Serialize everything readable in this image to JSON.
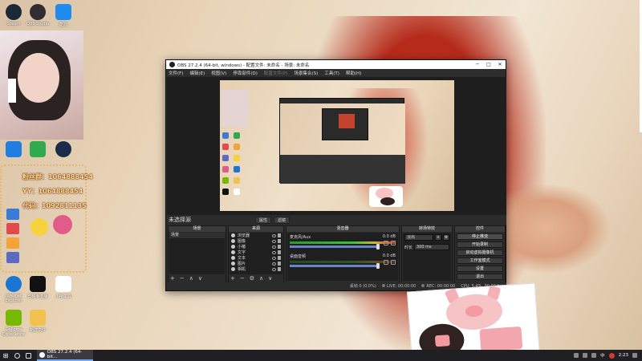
{
  "desktop": {
    "top_icons": [
      {
        "label": "Steam",
        "color": "#1b2838"
      },
      {
        "label": "OBS Studio",
        "color": "#302e31"
      },
      {
        "label": "酷狗",
        "color": "#1f8cf0"
      }
    ],
    "left_icons": [
      {
        "label": "",
        "color": "#1f7ee0"
      },
      {
        "label": "",
        "color": "#2faa4e"
      },
      {
        "label": "",
        "color": "#1d2b4a"
      }
    ],
    "overlay_texts": [
      "粉丝群：1064888454",
      "YY：1064888454",
      "代码：1092811135"
    ],
    "bottom_icons": [
      {
        "label": "Internet Explorer",
        "color": "#1a76d2"
      },
      {
        "label": "剪映专业版",
        "color": "#111111"
      },
      {
        "label": "小哈工具",
        "color": "#ffffff"
      },
      {
        "label": "GeForce Experience",
        "color": "#76b900"
      },
      {
        "label": "新建文件",
        "color": "#f2c14e"
      }
    ]
  },
  "obs": {
    "title": "OBS 27.2.4 (64-bit, windows) - 配置文件: 未命名 - 场景: 未命名",
    "menu": [
      {
        "label": "文件(F)",
        "dim": false
      },
      {
        "label": "编辑(E)",
        "dim": false
      },
      {
        "label": "视图(V)",
        "dim": false
      },
      {
        "label": "停靠部件(D)",
        "dim": false
      },
      {
        "label": "配置文件(P)",
        "dim": true
      },
      {
        "label": "场景集合(S)",
        "dim": false
      },
      {
        "label": "工具(T)",
        "dim": false
      },
      {
        "label": "帮助(H)",
        "dim": false
      }
    ],
    "scene_toolbar": {
      "left": "未选择源",
      "btn1": "属性",
      "btn2": "滤镜"
    },
    "docks": {
      "scenes": {
        "title": "场景",
        "items": [
          "场景"
        ]
      },
      "sources": {
        "title": "来源",
        "items": [
          "浏览器",
          "图像",
          "小猪",
          "文字",
          "文本",
          "图片",
          "相机"
        ]
      },
      "mixer": {
        "title": "混音器",
        "channels": [
          {
            "name": "麦克风/Aux",
            "db": "0.0 dB"
          },
          {
            "name": "桌面音频",
            "db": "0.0 dB"
          }
        ]
      },
      "transitions": {
        "title": "转场特效",
        "type": "淡出",
        "duration_label": "时长",
        "duration": "300 ms"
      },
      "controls": {
        "title": "控件",
        "buttons": [
          "停止推流",
          "开始录制",
          "启动虚拟摄像机",
          "工作室模式",
          "设置",
          "退出"
        ]
      }
    },
    "status": {
      "dropped": "丢帧 0 (0.0%)",
      "live": "LIVE: 00:00:00",
      "rec": "REC: 00:00:00",
      "cpu": "CPU: 5.4%, 30.00 fps"
    }
  },
  "taskbar": {
    "app_label": "OBS 27.2.4 (64-bit...",
    "tray_lang": "中",
    "time": "2:23"
  }
}
